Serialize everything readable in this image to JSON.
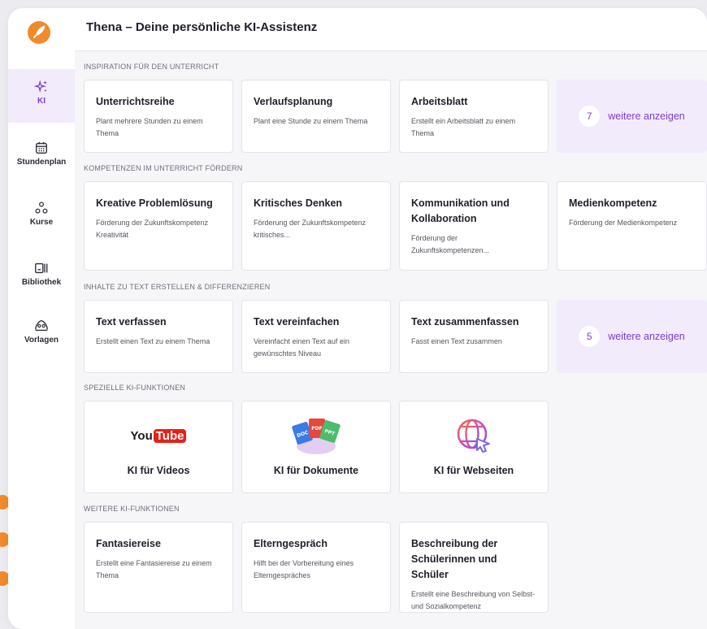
{
  "header": {
    "title": "Thena – Deine persönliche KI-Assistenz"
  },
  "sidebar": {
    "items": [
      {
        "label": "KI",
        "icon": "sparkles-icon"
      },
      {
        "label": "Stundenplan",
        "icon": "calendar-icon"
      },
      {
        "label": "Kurse",
        "icon": "courses-icon"
      },
      {
        "label": "Bibliothek",
        "icon": "library-icon"
      },
      {
        "label": "Vorlagen",
        "icon": "templates-icon"
      }
    ]
  },
  "sections": {
    "inspiration": {
      "label": "INSPIRATION FÜR DEN UNTERRICHT",
      "cards": [
        {
          "title": "Unterrichtsreihe",
          "desc": "Plant mehrere Stunden zu einem Thema"
        },
        {
          "title": "Verlaufsplanung",
          "desc": "Plant eine Stunde zu einem Thema"
        },
        {
          "title": "Arbeitsblatt",
          "desc": "Erstellt ein Arbeitsblatt zu einem Thema"
        }
      ],
      "more": {
        "count": "7",
        "label": "weitere anzeigen"
      }
    },
    "kompetenzen": {
      "label": "KOMPETENZEN IM UNTERRICHT FÖRDERN",
      "cards": [
        {
          "title": "Kreative Problemlösung",
          "desc": "Förderung der Zukunftskompetenz Kreativität"
        },
        {
          "title": "Kritisches Denken",
          "desc": "Förderung der Zukunftskompetenz kritisches..."
        },
        {
          "title": "Kommunikation und Kollaboration",
          "desc": "Förderung der Zukunftskompetenzen..."
        },
        {
          "title": "Medienkompetenz",
          "desc": "Förderung der Medienkompetenz"
        }
      ]
    },
    "inhalte": {
      "label": "INHALTE ZU TEXT ERSTELLEN & DIFFERENZIEREN",
      "cards": [
        {
          "title": "Text verfassen",
          "desc": "Erstellt einen Text zu einem Thema"
        },
        {
          "title": "Text vereinfachen",
          "desc": "Vereinfacht einen Text auf ein gewünschtes Niveau"
        },
        {
          "title": "Text zusammenfassen",
          "desc": "Fasst einen Text zusammen"
        }
      ],
      "more": {
        "count": "5",
        "label": "weitere anzeigen"
      }
    },
    "spezielle": {
      "label": "SPEZIELLE KI-FUNKTIONEN",
      "cards": [
        {
          "title": "KI für Videos",
          "icon": "youtube-logo",
          "logo_you": "You",
          "logo_tube": "Tube"
        },
        {
          "title": "KI für Dokumente",
          "icon": "documents-cloud-icon",
          "doc_labels": [
            "DOC",
            "PDF",
            "PPT"
          ]
        },
        {
          "title": "KI für Webseiten",
          "icon": "globe-cursor-icon"
        }
      ]
    },
    "weitere": {
      "label": "WEITERE KI-FUNKTIONEN",
      "cards": [
        {
          "title": "Fantasiereise",
          "desc": "Erstellt eine Fantasiereise zu einem Thema"
        },
        {
          "title": "Elterngespräch",
          "desc": "Hilft bei der Vorbereitung eines Elterngespräches"
        },
        {
          "title": "Beschreibung der Schülerinnen und Schüler",
          "desc": "Erstellt eine Beschreibung von Selbst- und Sozialkompetenz"
        }
      ]
    }
  },
  "colors": {
    "accent": "#7b3fd6",
    "accent_bg": "#f1ebfb",
    "brand_orange": "#f08a2c"
  }
}
